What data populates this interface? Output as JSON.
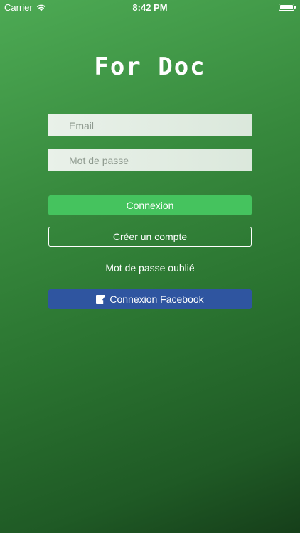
{
  "status_bar": {
    "carrier": "Carrier",
    "wifi_icon": "wifi-icon",
    "time": "8:42 PM",
    "battery_icon": "battery-icon"
  },
  "app": {
    "title": "For Doc"
  },
  "form": {
    "email_placeholder": "Email",
    "email_value": "",
    "password_placeholder": "Mot de passe",
    "password_value": "",
    "login_label": "Connexion",
    "create_account_label": "Créer un compte",
    "forgot_password_label": "Mot de passe oublié",
    "facebook_label": "Connexion Facebook",
    "facebook_icon": "facebook-icon",
    "facebook_icon_glyph": "f"
  },
  "colors": {
    "background_top": "#4daa54",
    "background_bottom": "#163f1a",
    "login_button": "#45c35e",
    "facebook_button": "#2f55a0",
    "field_background": "#e2ede3"
  }
}
